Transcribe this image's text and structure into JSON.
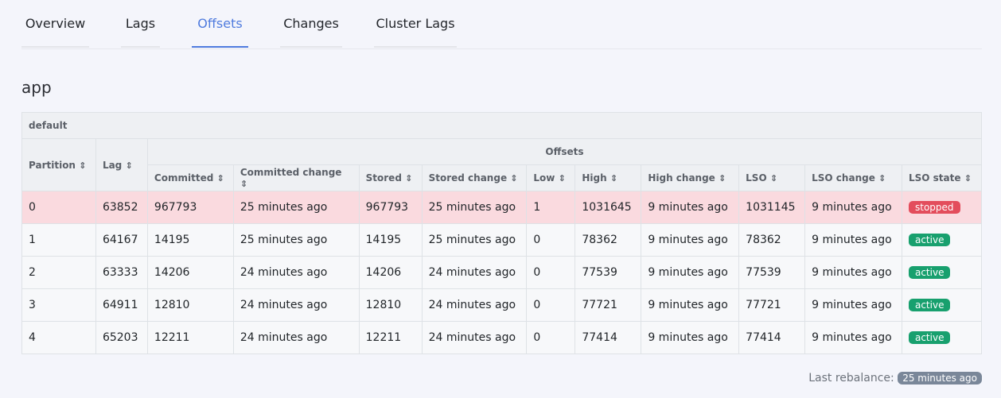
{
  "tabs": [
    "Overview",
    "Lags",
    "Offsets",
    "Changes",
    "Cluster Lags"
  ],
  "active_tab": "Offsets",
  "group_name": "app",
  "table": {
    "title": "default",
    "group_header": "Offsets",
    "sort_glyph": "⇕",
    "columns": [
      "Partition",
      "Lag",
      "Committed",
      "Committed change",
      "Stored",
      "Stored change",
      "Low",
      "High",
      "High change",
      "LSO",
      "LSO change",
      "LSO state"
    ],
    "rows": [
      [
        "0",
        "63852",
        "967793",
        "25 minutes ago",
        "967793",
        "25 minutes ago",
        "1",
        "1031645",
        "9 minutes ago",
        "1031145",
        "9 minutes ago",
        "stopped"
      ],
      [
        "1",
        "64167",
        "14195",
        "25 minutes ago",
        "14195",
        "25 minutes ago",
        "0",
        "78362",
        "9 minutes ago",
        "78362",
        "9 minutes ago",
        "active"
      ],
      [
        "2",
        "63333",
        "14206",
        "24 minutes ago",
        "14206",
        "24 minutes ago",
        "0",
        "77539",
        "9 minutes ago",
        "77539",
        "9 minutes ago",
        "active"
      ],
      [
        "3",
        "64911",
        "12810",
        "24 minutes ago",
        "12810",
        "24 minutes ago",
        "0",
        "77721",
        "9 minutes ago",
        "77721",
        "9 minutes ago",
        "active"
      ],
      [
        "4",
        "65203",
        "12211",
        "24 minutes ago",
        "12211",
        "24 minutes ago",
        "0",
        "77414",
        "9 minutes ago",
        "77414",
        "9 minutes ago",
        "active"
      ]
    ]
  },
  "footer": {
    "label": "Last rebalance:",
    "value": "25 minutes ago"
  },
  "colors": {
    "accent": "#4f7bde",
    "stopped_badge": "#e34d5c",
    "active_badge": "#18a06e",
    "danger_row": "#fadadf"
  }
}
